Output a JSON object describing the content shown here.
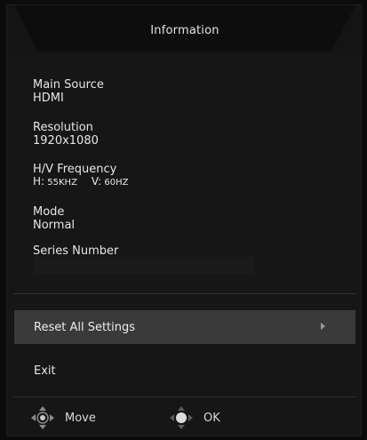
{
  "header": {
    "title": "Information"
  },
  "info": {
    "main_source": {
      "label": "Main Source",
      "value": "HDMI"
    },
    "resolution": {
      "label": "Resolution",
      "value": "1920x1080"
    },
    "frequency": {
      "label": "H/V Frequency",
      "h_label": "H:",
      "h_value": "55KHZ",
      "v_label": "V:",
      "v_value": "60HZ"
    },
    "mode": {
      "label": "Mode",
      "value": "Normal"
    },
    "series": {
      "label": "Series Number",
      "value": ""
    }
  },
  "menu": {
    "reset_label": "Reset All Settings",
    "exit_label": "Exit"
  },
  "footer": {
    "move_label": "Move",
    "ok_label": "OK"
  },
  "colors": {
    "background": "#161616",
    "selected_row": "#3a3a3a",
    "text": "#e6e6e6"
  }
}
